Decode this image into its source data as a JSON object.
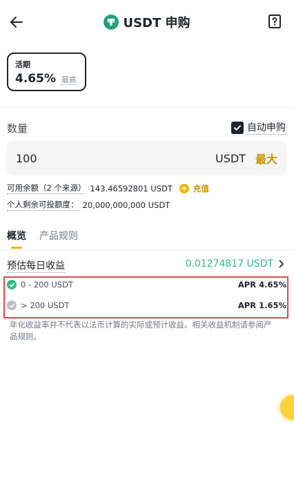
{
  "header": {
    "title": "USDT 申购",
    "back_icon": "arrow-left-icon",
    "help_icon": "help-book-icon"
  },
  "term_card": {
    "label": "活期",
    "rate": "4.65%",
    "suffix": "最高"
  },
  "quantity": {
    "label": "数量",
    "auto_subscribe_label": "自动申购",
    "auto_subscribe_checked": true,
    "input_value": "100",
    "unit": "USDT",
    "max_label": "最大"
  },
  "balance": {
    "available_label": "可用余额（2 个来源）",
    "available_value": "143.46592801 USDT",
    "deposit_label": "充值",
    "quota_label": "个人剩余可投额度：",
    "quota_value": "20,000,000,000 USDT"
  },
  "tabs": [
    {
      "label": "概览",
      "active": true
    },
    {
      "label": "产品规则",
      "active": false
    }
  ],
  "earnings": {
    "label": "预估每日收益",
    "value": "0.01274817 USDT"
  },
  "tiers": [
    {
      "range": "0 - 200 USDT",
      "apr": "APR 4.65%",
      "active": true
    },
    {
      "range": "> 200 USDT",
      "apr": "APR 1.65%",
      "active": false
    }
  ],
  "disclaimer": "年化收益率并不代表以法币计算的实际或预计收益。相关收益机制请参阅产品规则。",
  "colors": {
    "brand_yellow": "#F0B90B",
    "positive_green": "#2EBD85",
    "usdt_green": "#26A17B",
    "highlight_red": "#E0484B"
  }
}
